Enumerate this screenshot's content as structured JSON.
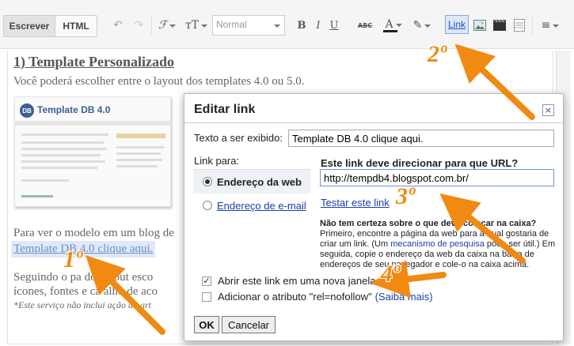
{
  "toolbar": {
    "compose_label": "Escrever",
    "html_label": "HTML",
    "font_select_value": "Normal",
    "bold_label": "B",
    "italic_label": "I",
    "underline_label": "U",
    "strike_label": "ABC",
    "link_label": "Link",
    "icons": [
      "undo-icon",
      "redo-icon",
      "font-family-icon",
      "font-size-icon",
      "bold-icon",
      "italic-icon",
      "underline-icon",
      "strikethrough-icon",
      "text-color-icon",
      "highlight-icon",
      "link-icon",
      "image-icon",
      "video-icon",
      "jump-break-icon",
      "align-icon"
    ]
  },
  "editor": {
    "section_title": "1) Template Personalizado",
    "intro": "Você poderá escolher entre o layout dos templates 4.0 ou 5.0.",
    "thumb_title": "Template DB 4.0",
    "thumb_logo": "DB",
    "para2": "Para ver o modelo em um blog de",
    "link_text": "Template DB 4.0 clique aqui.",
    "para3a": "Seguindo o pa          do layout esco",
    "para3b": "ícones, fontes e ca        alho de aco",
    "note": "*Este serviço não inclui         ação da art"
  },
  "dialog": {
    "title": "Editar link",
    "close_glyph": "×",
    "display_label": "Texto a ser exibido:",
    "display_value": "Template DB 4.0 clique aqui.",
    "link_to_label": "Link para:",
    "web_option": "Endereço da web",
    "email_option": "Endereço de e-mail",
    "url_question": "Este link deve direcionar para que URL?",
    "url_value": "http://tempdb4.blogspot.com.br/",
    "test_link": "Testar este link",
    "help_title": "Não tem certeza sobre o que deve colocar na caixa?",
    "help_1": "Primeiro, encontre a página da web para a qual gostaria de criar um link. (Um ",
    "help_link": "mecanismo de pesquisa",
    "help_2": " pode ser útil.) Em seguida, copie o endereço da web da caixa na barra de endereços de seu navegador e cole-o na caixa acima.",
    "new_window_label": "Abrir este link em uma nova janela",
    "new_window_checked": true,
    "check_glyph": "✓",
    "nofollow_label": "Adicionar o atributo \"rel=nofollow\"",
    "learn_more": "(Saiba mais)",
    "ok_label": "OK",
    "cancel_label": "Cancelar"
  },
  "annotations": {
    "step1": "1º",
    "step2": "2º",
    "step3": "3º",
    "step4": "4º",
    "arrow_color": "#f08a12"
  }
}
